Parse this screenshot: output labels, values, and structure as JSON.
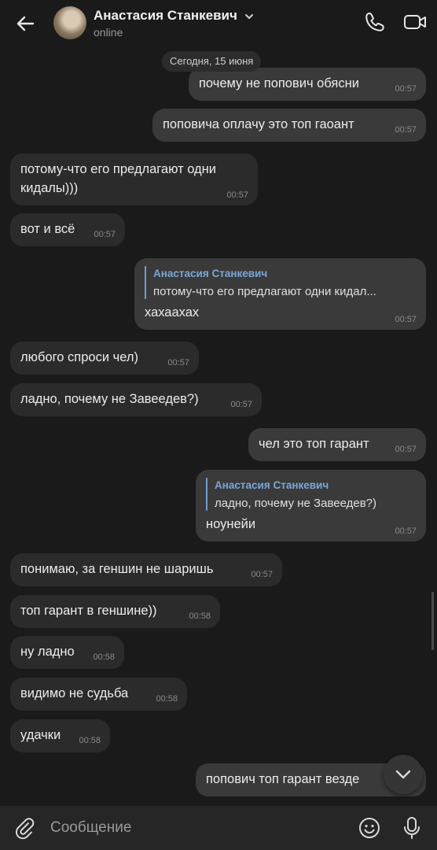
{
  "header": {
    "contact_name": "Анастасия Станкевич",
    "status": "online",
    "icons": [
      "back-arrow-icon",
      "chevron-down-icon",
      "phone-icon",
      "video-camera-icon"
    ]
  },
  "date_separator": "Сегодня, 15 июня",
  "messages": [
    {
      "dir": "out",
      "text": "почему не попович обясни",
      "time": "00:57"
    },
    {
      "dir": "out",
      "text": "поповича оплачу это топ гаоант",
      "time": "00:57"
    },
    {
      "dir": "in",
      "lines": [
        "потому-что его предлагают одни",
        "кидалы)))"
      ],
      "time": "00:57"
    },
    {
      "dir": "in",
      "text": "вот и всё",
      "time": "00:57"
    },
    {
      "dir": "out",
      "reply": {
        "author": "Анастасия Станкевич",
        "text": "потому-что его предлагают одни кидал..."
      },
      "text": "хахаахах",
      "time": "00:57"
    },
    {
      "dir": "in",
      "text": "любого спроси чел)",
      "time": "00:57"
    },
    {
      "dir": "in",
      "text": "ладно, почему не Завеедев?)",
      "time": "00:57"
    },
    {
      "dir": "out",
      "text": "чел это топ гарант",
      "time": "00:57"
    },
    {
      "dir": "out",
      "reply": {
        "author": "Анастасия Станкевич",
        "text": "ладно, почему не Завеедев?)"
      },
      "text": "ноунейи",
      "time": "00:57"
    },
    {
      "dir": "in",
      "text": "понимаю, за геншин не шаришь",
      "time": "00:57"
    },
    {
      "dir": "in",
      "text": "топ гарант в геншине))",
      "time": "00:58"
    },
    {
      "dir": "in",
      "text": "ну ладно",
      "time": "00:58"
    },
    {
      "dir": "in",
      "text": "видимо не судьба",
      "time": "00:58"
    },
    {
      "dir": "in",
      "text": "удачки",
      "time": "00:58"
    },
    {
      "dir": "out",
      "text": "попович топ гарант везде"
    }
  ],
  "composer": {
    "placeholder": "Сообщение",
    "icons": [
      "attach-icon",
      "emoji-icon",
      "microphone-icon"
    ]
  },
  "colors": {
    "background": "#1a1a1a",
    "incoming_bubble": "#2b2b2b",
    "outgoing_bubble": "#3a3a3a",
    "reply_accent": "#7ba7d6"
  }
}
